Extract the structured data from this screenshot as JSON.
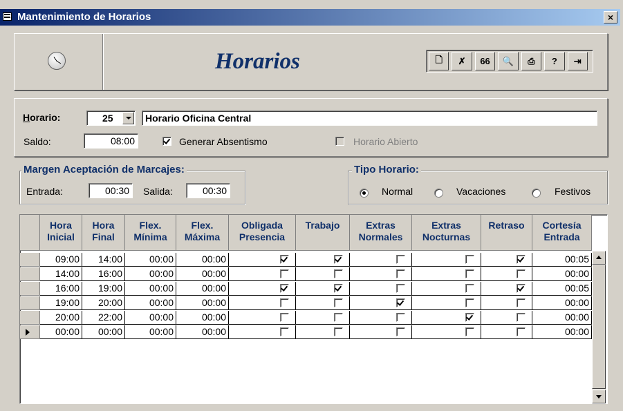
{
  "window": {
    "title": "Mantenimiento de Horarios",
    "close_label": "×"
  },
  "header": {
    "title": "Horarios"
  },
  "toolbar": {
    "buttons": [
      {
        "name": "new-record-icon",
        "glyph": "🗋"
      },
      {
        "name": "delete-record-icon",
        "glyph": "✗"
      },
      {
        "name": "find-icon",
        "glyph": "66"
      },
      {
        "name": "print-preview-icon",
        "glyph": "🔍"
      },
      {
        "name": "print-icon",
        "glyph": "⎙"
      },
      {
        "name": "help-icon",
        "glyph": "?"
      },
      {
        "name": "exit-icon",
        "glyph": "⇥"
      }
    ]
  },
  "horario": {
    "label": "Horario:",
    "code": "25",
    "name": "Horario Oficina Central",
    "saldo_label": "Saldo:",
    "saldo": "08:00",
    "generar_absentismo_label": "Generar Absentismo",
    "generar_absentismo": true,
    "horario_abierto_label": "Horario Abierto",
    "horario_abierto": false
  },
  "margen": {
    "title": "Margen Aceptación de Marcajes:",
    "entrada_label": "Entrada:",
    "entrada": "00:30",
    "salida_label": "Salida:",
    "salida": "00:30"
  },
  "tipo": {
    "title": "Tipo Horario:",
    "options": [
      "Normal",
      "Vacaciones",
      "Festivos"
    ],
    "selected": "Normal"
  },
  "grid": {
    "columns": [
      [
        "Hora",
        "Inicial"
      ],
      [
        "Hora",
        "Final"
      ],
      [
        "Flex.",
        "Mínima"
      ],
      [
        "Flex.",
        "Máxima"
      ],
      [
        "Obligada",
        "Presencia"
      ],
      [
        "Trabajo",
        ""
      ],
      [
        "Extras",
        "Normales"
      ],
      [
        "Extras",
        "Nocturnas"
      ],
      [
        "Retraso",
        ""
      ],
      [
        "Cortesía",
        "Entrada"
      ]
    ],
    "rows": [
      {
        "inicial": "09:00",
        "final": "14:00",
        "min": "00:00",
        "max": "00:00",
        "obligada": true,
        "trabajo": true,
        "ext_norm": false,
        "ext_noct": false,
        "retraso": true,
        "cortesia": "00:05"
      },
      {
        "inicial": "14:00",
        "final": "16:00",
        "min": "00:00",
        "max": "00:00",
        "obligada": false,
        "trabajo": false,
        "ext_norm": false,
        "ext_noct": false,
        "retraso": false,
        "cortesia": "00:00"
      },
      {
        "inicial": "16:00",
        "final": "19:00",
        "min": "00:00",
        "max": "00:00",
        "obligada": true,
        "trabajo": true,
        "ext_norm": false,
        "ext_noct": false,
        "retraso": true,
        "cortesia": "00:05"
      },
      {
        "inicial": "19:00",
        "final": "20:00",
        "min": "00:00",
        "max": "00:00",
        "obligada": false,
        "trabajo": false,
        "ext_norm": true,
        "ext_noct": false,
        "retraso": false,
        "cortesia": "00:00"
      },
      {
        "inicial": "20:00",
        "final": "22:00",
        "min": "00:00",
        "max": "00:00",
        "obligada": false,
        "trabajo": false,
        "ext_norm": false,
        "ext_noct": true,
        "retraso": false,
        "cortesia": "00:00"
      },
      {
        "inicial": "00:00",
        "final": "00:00",
        "min": "00:00",
        "max": "00:00",
        "obligada": false,
        "trabajo": false,
        "ext_norm": false,
        "ext_noct": false,
        "retraso": false,
        "cortesia": "00:00",
        "current": true
      }
    ]
  }
}
